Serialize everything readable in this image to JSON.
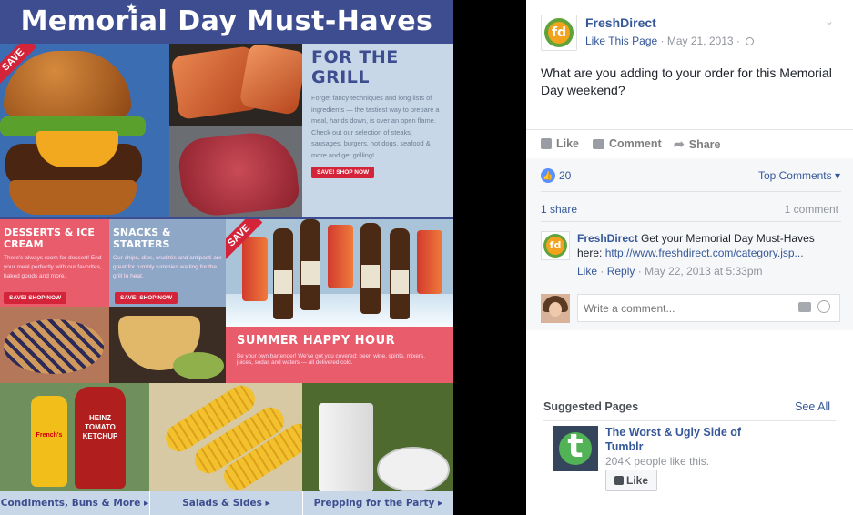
{
  "promo": {
    "title": "Memorial Day Must-Haves",
    "save_label": "SAVE",
    "grill_heading": "FOR THE GRILL",
    "grill_body": "Forget fancy techniques and long lists of ingredients — the tastiest way to prepare a meal, hands down, is over an open flame. Check out our selection of steaks, sausages, burgers, hot dogs, seafood & more and get grilling!",
    "shop_label": "SAVE! SHOP NOW",
    "desserts_heading": "DESSERTS & ICE CREAM",
    "desserts_body": "There's always room for dessert! End your meal perfectly with our favorites, baked goods and more.",
    "snacks_heading": "SNACKS & STARTERS",
    "snacks_body": "Our chips, dips, crudités and antipasti are great for rumbly tummies waiting for the grill to heat.",
    "summer_heading": "SUMMER HAPPY HOUR",
    "summer_body": "Be your own bartender! We've got you covered: beer, wine, spirits, mixers, juices, sodas and waters — all delivered cold.",
    "mustard_label": "French's",
    "ketchup_label": "HEINZ TOMATO KETCHUP",
    "bottom_links": [
      "Condiments, Buns & More ▸",
      "Salads & Sides ▸",
      "Prepping for the Party ▸"
    ]
  },
  "post": {
    "page_name": "FreshDirect",
    "logo_text": "fd",
    "like_link": "Like This Page",
    "date": "May 21, 2013",
    "separator": "·",
    "chevron": "⌄",
    "text": "What are you adding to your order for this Memorial Day weekend?",
    "actions": {
      "like": "Like",
      "comment": "Comment",
      "share": "Share"
    },
    "reaction_count": "20",
    "top_comments": "Top Comments ▾",
    "shares": "1 share",
    "comments": "1 comment"
  },
  "comment": {
    "author": "FreshDirect",
    "text": "Get your Memorial Day Must-Haves here:",
    "link": "http://www.freshdirect.com/category.jsp...",
    "like": "Like",
    "reply": "Reply",
    "time": "May 22, 2013 at 5:33pm"
  },
  "compose": {
    "placeholder": "Write a comment..."
  },
  "suggested": {
    "title": "Suggested Pages",
    "see_all": "See All",
    "page_name": "The Worst & Ugly Side of Tumblr",
    "likes": "204K people like this.",
    "like_button": "Like",
    "logo_letter": "t"
  },
  "colors": {
    "fb_link": "#365899",
    "promo_blue": "#3d4d8f",
    "promo_red": "#e95c6c"
  }
}
